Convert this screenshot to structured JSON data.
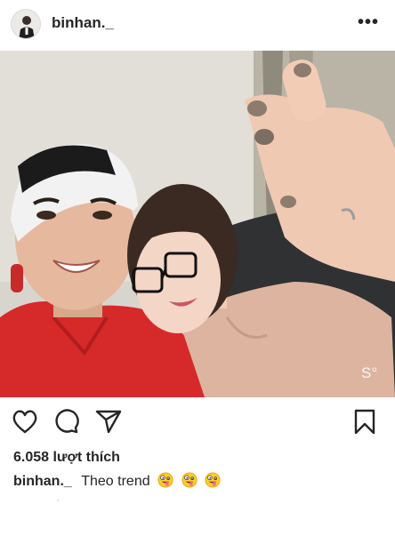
{
  "post": {
    "username": "binhan._",
    "likes": "6.058 lượt thích",
    "caption_user": "binhan._",
    "caption_text": "Theo trend",
    "caption_emojis": [
      "zany-face",
      "zany-face",
      "zany-face"
    ],
    "photo_watermark": "S°"
  },
  "icons": {
    "more": "more-options-icon",
    "like": "heart-icon",
    "comment": "comment-icon",
    "share": "send-icon",
    "save": "bookmark-icon"
  },
  "colors": {
    "text": "#262626",
    "shirt": "#d62a2a",
    "background": "#ffffff"
  }
}
